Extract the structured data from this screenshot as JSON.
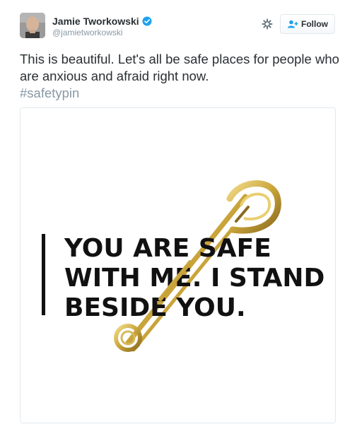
{
  "user": {
    "name": "Jamie Tworkowski",
    "handle": "@jamietworkowski",
    "verified": true
  },
  "actions": {
    "follow_label": "Follow",
    "settings_icon": "gear-icon",
    "follow_icon": "add-user-icon"
  },
  "tweet": {
    "text": "This is beautiful. Let's all be safe places for people who are anxious and afraid right now.",
    "hashtag": "#safetypin"
  },
  "media": {
    "line1": "YOU ARE SAFE",
    "line2": "WITH ME. I STAND",
    "line3": "BESIDE YOU."
  },
  "colors": {
    "text": "#292f33",
    "muted": "#8899a6",
    "verified": "#1da1f2",
    "border": "#e1e8ed",
    "pin_gold": "#c9a43a"
  }
}
